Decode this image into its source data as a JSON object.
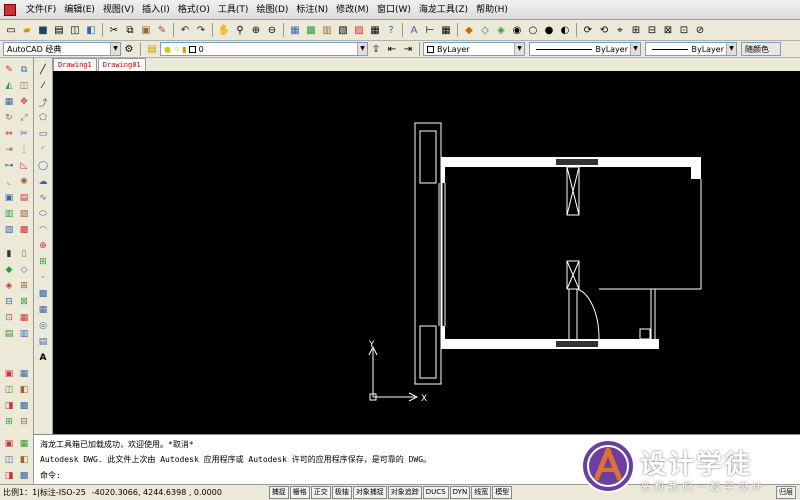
{
  "menubar": {
    "items": [
      {
        "label": "文件(F)"
      },
      {
        "label": "编辑(E)"
      },
      {
        "label": "视图(V)"
      },
      {
        "label": "插入(I)"
      },
      {
        "label": "格式(O)"
      },
      {
        "label": "工具(T)"
      },
      {
        "label": "绘图(D)"
      },
      {
        "label": "标注(N)"
      },
      {
        "label": "修改(M)"
      },
      {
        "label": "窗口(W)"
      },
      {
        "label": "海龙工具(Z)"
      },
      {
        "label": "帮助(H)"
      }
    ]
  },
  "toolbar2": {
    "workspace": "AutoCAD 经典",
    "layer": "0",
    "color": "ByLayer",
    "linetype": "ByLayer",
    "lineweight": "ByLayer",
    "plotstyle": "随颜色"
  },
  "tabs": [
    {
      "label": "Drawing1"
    },
    {
      "label": "Drawing01"
    }
  ],
  "canvas": {
    "ucs_y": "Y",
    "ucs_x": "X"
  },
  "command": {
    "line1": "海龙工具箱已加载成功，欢迎使用。*取消*",
    "line2": "Autodesk DWG.  此文件上次由 Autodesk 应用程序或 Autodesk 许可的应用程序保存，是可靠的 DWG。",
    "prompt": "命令:"
  },
  "status": {
    "scale": "比例1：1|标注-ISO-25",
    "coords": "-4020.3066, 4244.6398 , 0.0000",
    "buttons": [
      {
        "label": "捕捉"
      },
      {
        "label": "栅格"
      },
      {
        "label": "正交"
      },
      {
        "label": "极轴"
      },
      {
        "label": "对象捕捉"
      },
      {
        "label": "对象追踪"
      },
      {
        "label": "DUCS"
      },
      {
        "label": "DYN"
      },
      {
        "label": "线宽"
      },
      {
        "label": "模型"
      }
    ],
    "right_label": "归层"
  },
  "watermark": {
    "title": "设计学徒",
    "subtitle": "来和我们一起学设计"
  }
}
